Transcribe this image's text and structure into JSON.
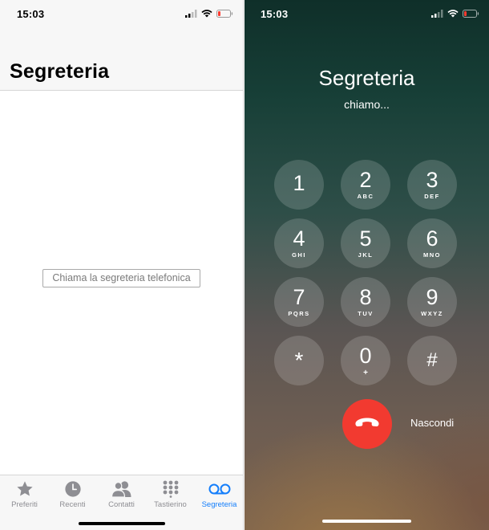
{
  "left": {
    "status": {
      "time": "15:03"
    },
    "title": "Segreteria",
    "call_button": "Chiama la segreteria telefonica",
    "tabs": [
      {
        "label": "Preferiti",
        "icon": "star-icon",
        "active": false
      },
      {
        "label": "Recenti",
        "icon": "clock-icon",
        "active": false
      },
      {
        "label": "Contatti",
        "icon": "contacts-icon",
        "active": false
      },
      {
        "label": "Tastierino",
        "icon": "keypad-icon",
        "active": false
      },
      {
        "label": "Segreteria",
        "icon": "voicemail-icon",
        "active": true
      }
    ]
  },
  "right": {
    "status": {
      "time": "15:03"
    },
    "call_name": "Segreteria",
    "call_status": "chiamo...",
    "keys": [
      {
        "digit": "1",
        "letters": ""
      },
      {
        "digit": "2",
        "letters": "ABC"
      },
      {
        "digit": "3",
        "letters": "DEF"
      },
      {
        "digit": "4",
        "letters": "GHI"
      },
      {
        "digit": "5",
        "letters": "JKL"
      },
      {
        "digit": "6",
        "letters": "MNO"
      },
      {
        "digit": "7",
        "letters": "PQRS"
      },
      {
        "digit": "8",
        "letters": "TUV"
      },
      {
        "digit": "9",
        "letters": "WXYZ"
      },
      {
        "digit": "*",
        "letters": ""
      },
      {
        "digit": "0",
        "letters": "+"
      },
      {
        "digit": "#",
        "letters": ""
      }
    ],
    "hide_label": "Nascondi"
  },
  "colors": {
    "accent_blue": "#147efb",
    "end_call_red": "#f23a30",
    "battery_low_red": "#ff3b30"
  }
}
